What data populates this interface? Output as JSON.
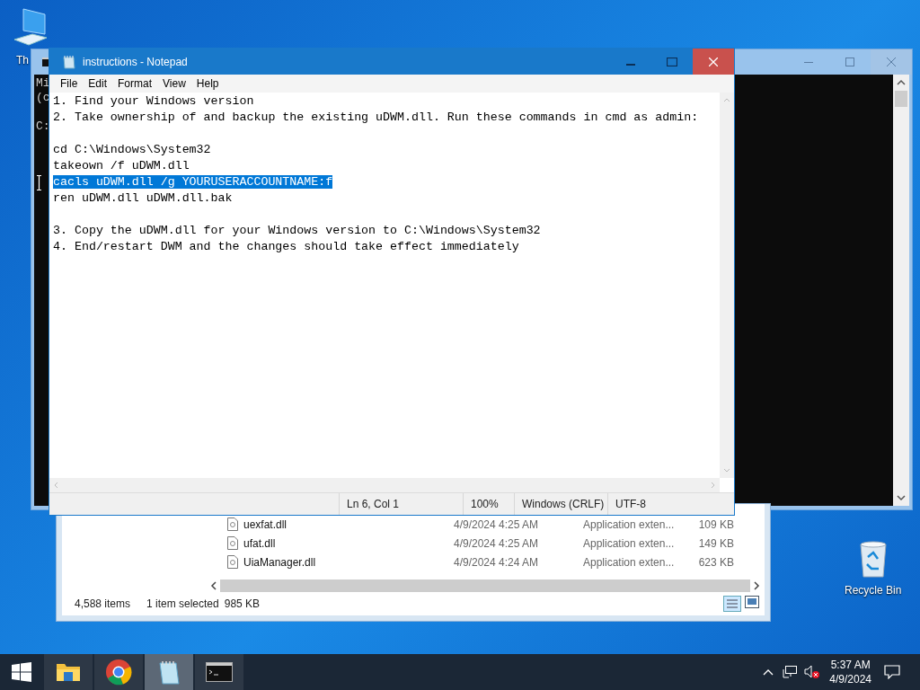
{
  "desktop_icons": [
    {
      "kind": "computer",
      "label": "Th"
    },
    {
      "kind": "recycle",
      "label": "Recycle Bin"
    }
  ],
  "console_window": {
    "paragraphs": [
      {
        "lines": [
          "Mi",
          "(c"
        ]
      },
      {
        "lines": [
          "C:"
        ]
      }
    ]
  },
  "explorer_window": {
    "rows": [
      {
        "name": "uexfat.dll",
        "date": "4/9/2024 4:25 AM",
        "type": "Application exten...",
        "size": "109 KB"
      },
      {
        "name": "ufat.dll",
        "date": "4/9/2024 4:25 AM",
        "type": "Application exten...",
        "size": "149 KB"
      },
      {
        "name": "UiaManager.dll",
        "date": "4/9/2024 4:24 AM",
        "type": "Application exten...",
        "size": "623 KB"
      }
    ],
    "status": {
      "count": "4,588 items",
      "selection": "1 item selected",
      "size": "985 KB"
    }
  },
  "notepad": {
    "title": "instructions - Notepad",
    "menu": [
      "File",
      "Edit",
      "Format",
      "View",
      "Help"
    ],
    "paragraphs": [
      {
        "lines": [
          {
            "text": "1. Find your Windows version",
            "selected": false
          },
          {
            "text": "2. Take ownership of and backup the existing uDWM.dll. Run these commands in cmd as admin:",
            "selected": false
          }
        ]
      },
      {
        "lines": [
          {
            "text": "cd C:\\Windows\\System32",
            "selected": false
          },
          {
            "text": "takeown /f uDWM.dll",
            "selected": false
          },
          {
            "text": "cacls uDWM.dll /g YOURUSERACCOUNTNAME:f",
            "selected": true
          },
          {
            "text": "ren uDWM.dll uDWM.dll.bak",
            "selected": false
          }
        ]
      },
      {
        "lines": [
          {
            "text": "3. Copy the uDWM.dll for your Windows version to C:\\Windows\\System32",
            "selected": false
          },
          {
            "text": "4. End/restart DWM and the changes should take effect immediately",
            "selected": false
          }
        ]
      }
    ],
    "status": [
      "Ln 6, Col 1",
      "100%",
      "Windows (CRLF)",
      "UTF-8"
    ]
  },
  "taskbar": {
    "apps": [
      {
        "kind": "folder",
        "selected": false
      },
      {
        "kind": "browser",
        "selected": false
      },
      {
        "kind": "notepad",
        "selected": true
      },
      {
        "kind": "console",
        "selected": false
      }
    ],
    "time": "5:37 AM",
    "date": "4/9/2024"
  }
}
